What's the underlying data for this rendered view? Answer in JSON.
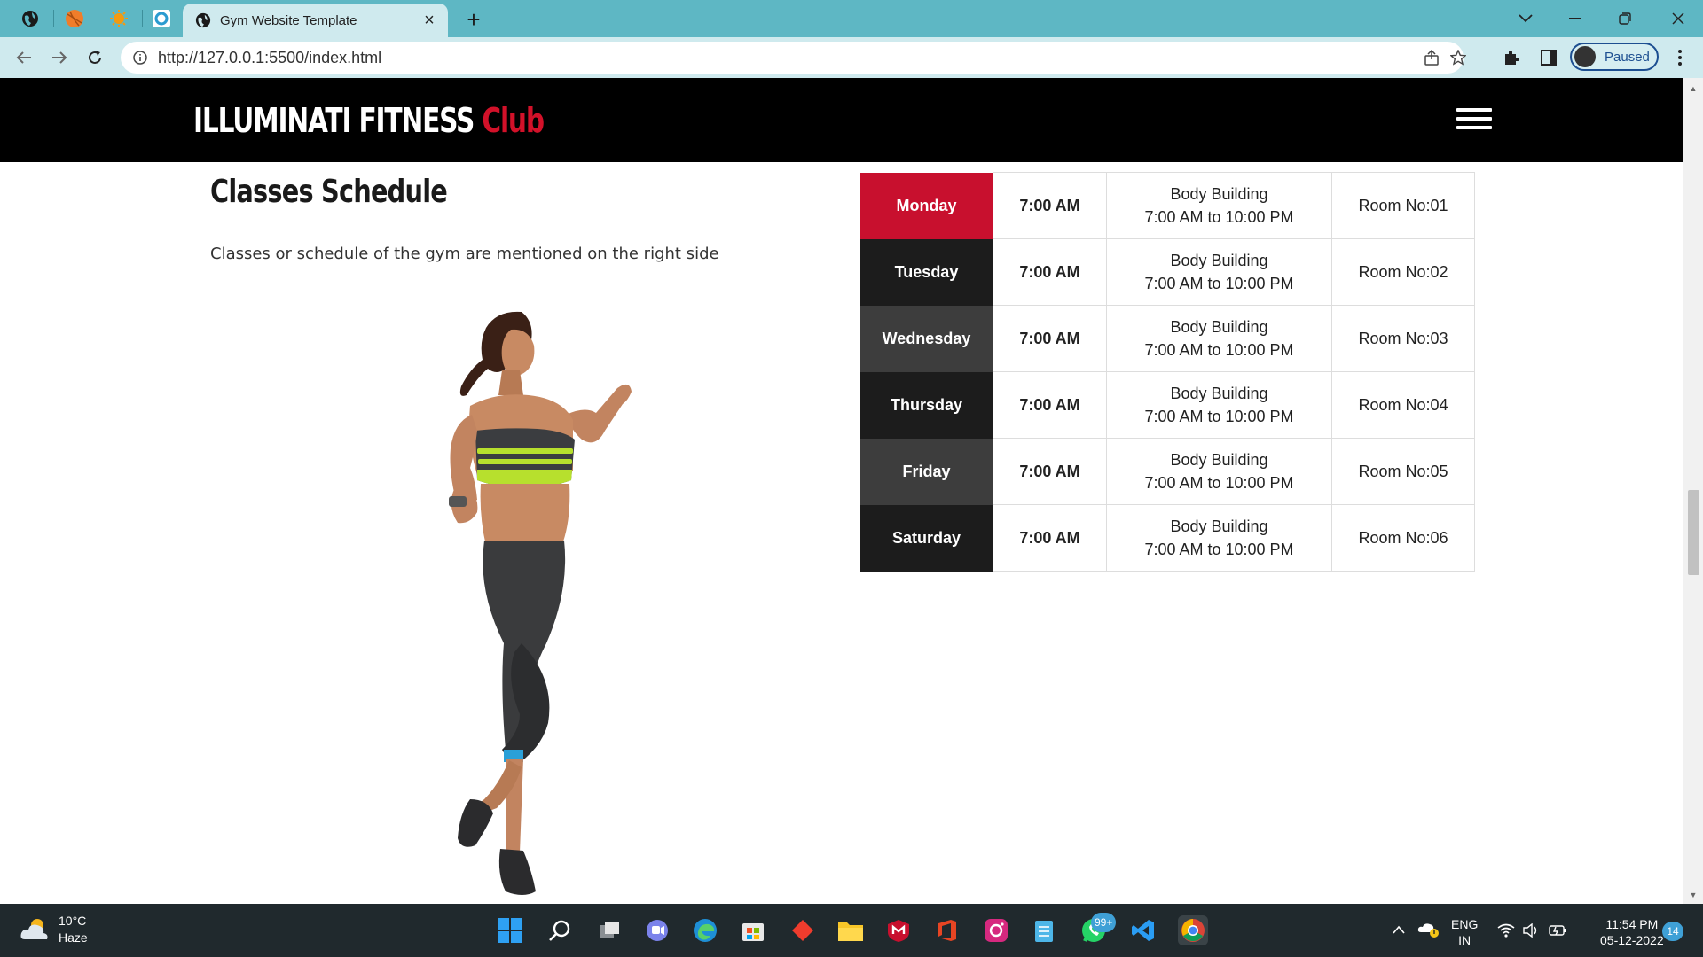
{
  "browser": {
    "tab_title": "Gym Website Template",
    "url": "http://127.0.0.1:5500/index.html",
    "profile_label": "Paused"
  },
  "site": {
    "brand_main": "ILLUMINATI FITNESS",
    "brand_accent": "Club",
    "accent_color": "#d21129"
  },
  "section": {
    "title": "Classes Schedule",
    "description": "Classes or schedule of the gym are mentioned on the right side"
  },
  "schedule": [
    {
      "day": "Monday",
      "time": "7:00 AM",
      "class_name": "Body Building",
      "class_hours": "7:00 AM to 10:00 PM",
      "room": "Room No:01",
      "day_color": "#c8102e"
    },
    {
      "day": "Tuesday",
      "time": "7:00 AM",
      "class_name": "Body Building",
      "class_hours": "7:00 AM to 10:00 PM",
      "room": "Room No:02",
      "day_color": "#1c1c1c"
    },
    {
      "day": "Wednesday",
      "time": "7:00 AM",
      "class_name": "Body Building",
      "class_hours": "7:00 AM to 10:00 PM",
      "room": "Room No:03",
      "day_color": "#3d3d3d"
    },
    {
      "day": "Thursday",
      "time": "7:00 AM",
      "class_name": "Body Building",
      "class_hours": "7:00 AM to 10:00 PM",
      "room": "Room No:04",
      "day_color": "#1c1c1c"
    },
    {
      "day": "Friday",
      "time": "7:00 AM",
      "class_name": "Body Building",
      "class_hours": "7:00 AM to 10:00 PM",
      "room": "Room No:05",
      "day_color": "#3d3d3d"
    },
    {
      "day": "Saturday",
      "time": "7:00 AM",
      "class_name": "Body Building",
      "class_hours": "7:00 AM to 10:00 PM",
      "room": "Room No:06",
      "day_color": "#1c1c1c"
    }
  ],
  "taskbar": {
    "weather_temp": "10°C",
    "weather_desc": "Haze",
    "whatsapp_badge": "99+",
    "lang_line1": "ENG",
    "lang_line2": "IN",
    "clock_time": "11:54 PM",
    "clock_date": "05-12-2022",
    "notification_count": "14"
  }
}
